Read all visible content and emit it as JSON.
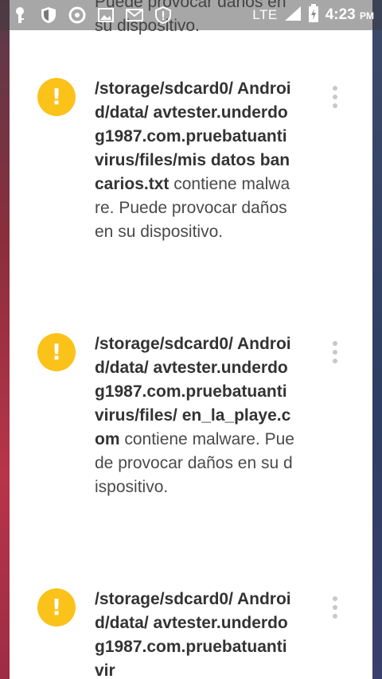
{
  "status_bar": {
    "network": "LTE",
    "time": "4:23",
    "ampm": "PM"
  },
  "top_fragment": "Puede provocar daños en su dispositivo.",
  "items": [
    {
      "path": "/storage/sdcard0/ Android/data/ avtester.underdog1987.com.pruebatuantivirus/files/mis datos bancarios.txt",
      "message": " contiene malware. Puede provocar daños en su dispositivo."
    },
    {
      "path": "/storage/sdcard0/ Android/data/ avtester.underdog1987.com.pruebatuantivirus/files/ en_la_playe.com",
      "message": " contiene malware. Puede provocar daños en su dispositivo."
    },
    {
      "path": "/storage/sdcard0/ Android/data/ avtester.underdog1987.com.pruebatuantivir",
      "message": ""
    }
  ],
  "colors": {
    "warning": "#fbc21a",
    "text": "#4a4a4a"
  }
}
